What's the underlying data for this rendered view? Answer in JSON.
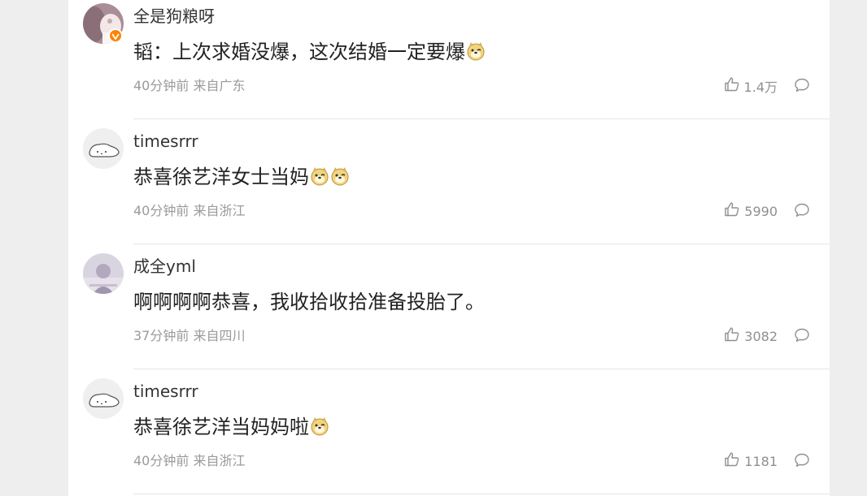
{
  "comments": [
    {
      "username": "全是狗粮呀",
      "content": "韬：上次求婚没爆，这次结婚一定要爆",
      "emojis": [
        "doge"
      ],
      "time": "40分钟前",
      "location": "来自广东",
      "likes": "1.4万",
      "verified": true
    },
    {
      "username": "timesrrr",
      "content": "恭喜徐艺洋女士当妈",
      "emojis": [
        "doge",
        "doge"
      ],
      "time": "40分钟前",
      "location": "来自浙江",
      "likes": "5990",
      "verified": false
    },
    {
      "username": "成全yml",
      "content": "啊啊啊啊恭喜，我收拾收拾准备投胎了。",
      "emojis": [],
      "time": "37分钟前",
      "location": "来自四川",
      "likes": "3082",
      "verified": false
    },
    {
      "username": "timesrrr",
      "content": "恭喜徐艺洋当妈妈啦",
      "emojis": [
        "doge"
      ],
      "time": "40分钟前",
      "location": "来自浙江",
      "likes": "1181",
      "verified": false
    }
  ],
  "icons": {
    "like": "thumbs-up-icon",
    "reply": "speech-bubble-icon",
    "emoji": "doge-emoji-icon",
    "verified": "verified-v-badge-icon"
  },
  "colors": {
    "verified_badge": "#ff8200",
    "meta_text": "#9a9a9a",
    "divider": "#e5e5e5",
    "page_bg": "#eeeeee"
  }
}
